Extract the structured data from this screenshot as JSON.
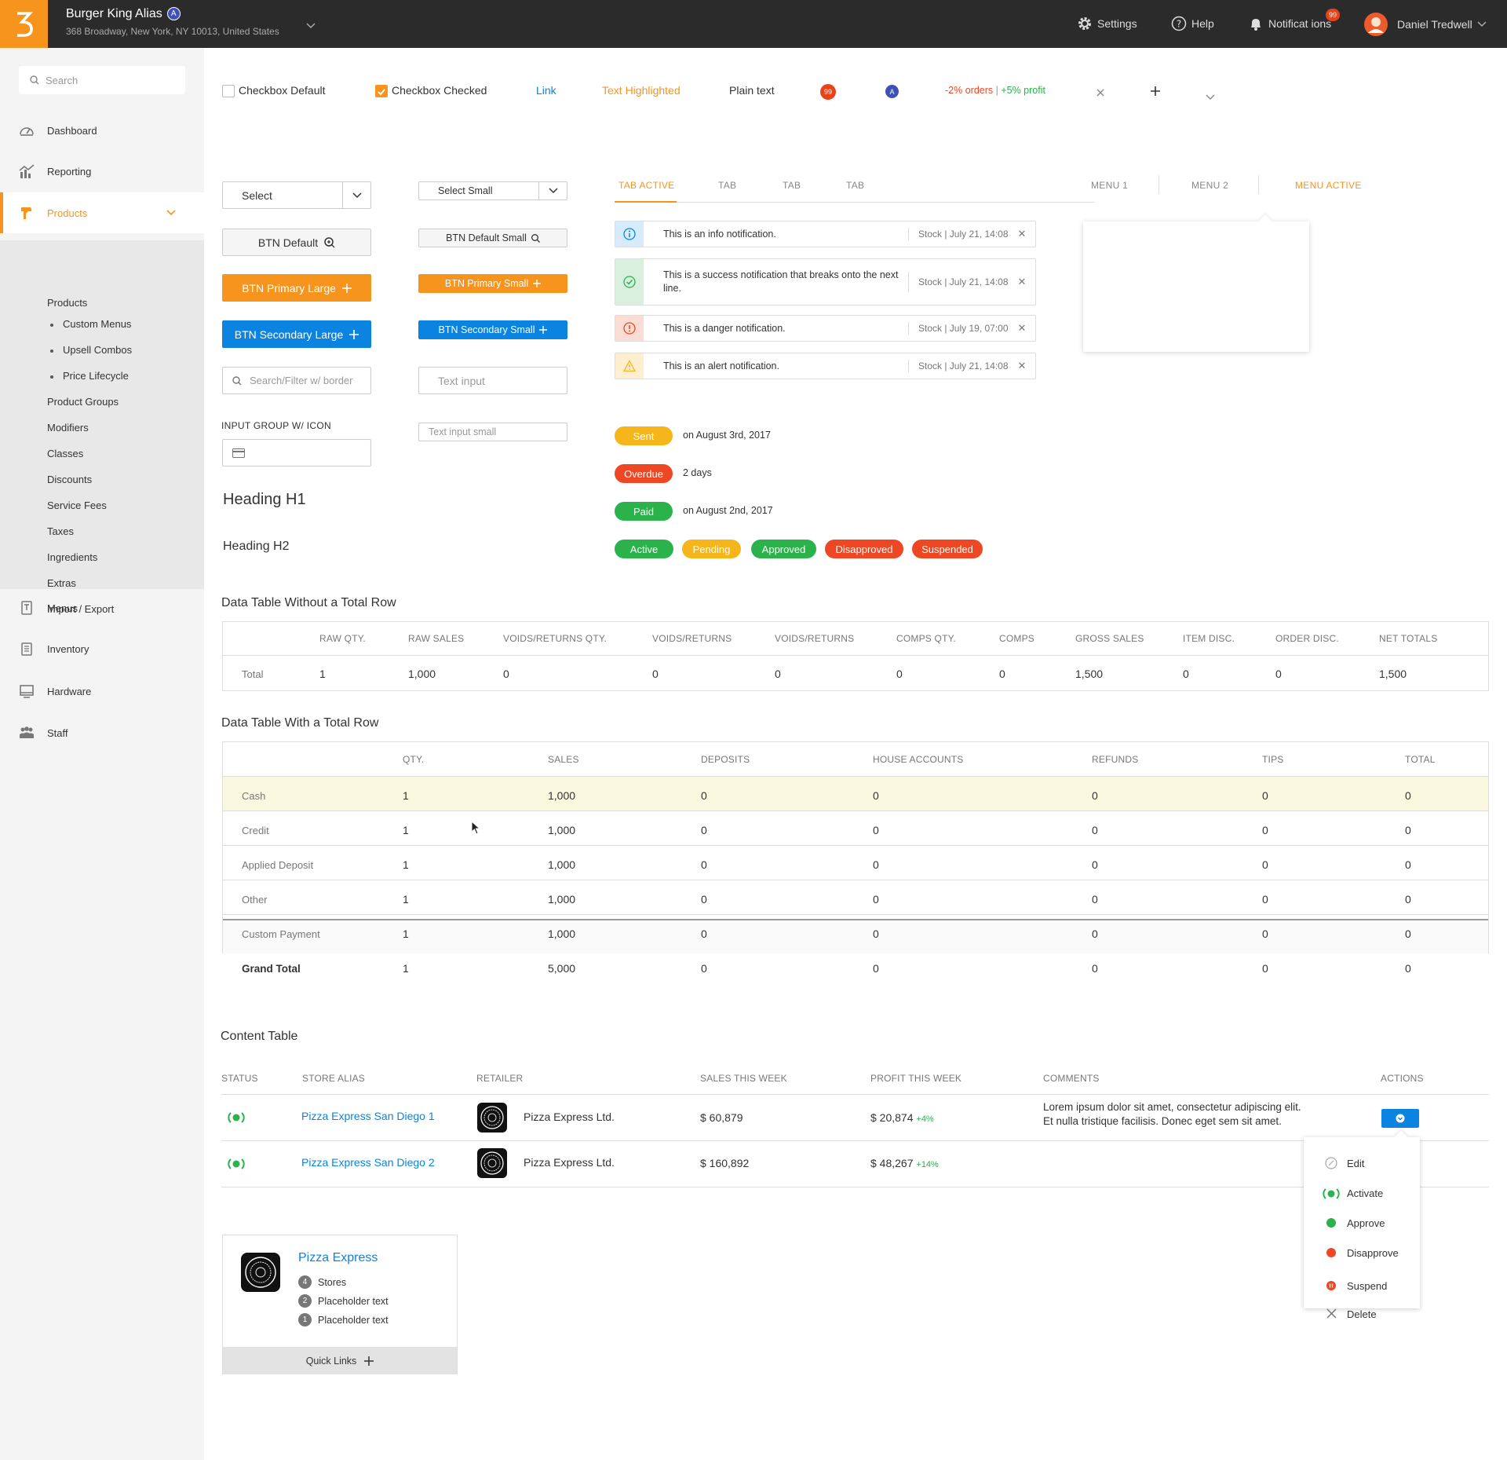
{
  "header": {
    "store_name": "Burger King Alias",
    "store_badge": "A",
    "store_address": "368 Broadway, New York, NY 10013, United States",
    "settings": "Settings",
    "help": "Help",
    "notifications": "Notificat ions",
    "notifications_count": "99",
    "user_name": "Daniel Tredwell"
  },
  "sidebar": {
    "search_placeholder": "Search",
    "items": [
      "Dashboard",
      "Reporting",
      "Products",
      "Menus",
      "Inventory",
      "Hardware",
      "Staff"
    ],
    "sub_items": [
      "Products",
      "Custom Menus",
      "Upsell Combos",
      "Price Lifecycle",
      "Product Groups",
      "Modifiers",
      "Classes",
      "Discounts",
      "Service Fees",
      "Taxes",
      "Ingredients",
      "Extras",
      "Import / Export"
    ]
  },
  "toprow": {
    "checkbox_default": "Checkbox Default",
    "checkbox_checked": "Checkbox Checked",
    "link": "Link",
    "highlighted": "Text Highlighted",
    "plain": "Plain text",
    "badge_count": "99",
    "badge_letter": "A",
    "orders": "-2% orders",
    "sep": " | ",
    "profit": "+5% profit"
  },
  "controls": {
    "select": "Select",
    "select_small": "Select Small",
    "btn_default": "BTN Default",
    "btn_default_small": "BTN Default Small",
    "btn_primary_large": "BTN Primary Large",
    "btn_primary_small": "BTN Primary Small",
    "btn_secondary_large": "BTN Secondary Large",
    "btn_secondary_small": "BTN Secondary Small",
    "search_filter_placeholder": "Search/Filter w/ border",
    "text_input_placeholder": "Text input",
    "input_group_label": "INPUT GROUP W/ ICON",
    "text_input_small_placeholder": "Text input small",
    "heading_h1": "Heading H1",
    "heading_h2": "Heading H2"
  },
  "tabs": [
    "TAB ACTIVE",
    "TAB",
    "TAB",
    "TAB"
  ],
  "menus": [
    "MENU 1",
    "MENU 2",
    "MENU ACTIVE"
  ],
  "notifications": [
    {
      "msg": "This is an info notification.",
      "meta": "Stock | July 21, 14:08"
    },
    {
      "msg": "This is a success notification that breaks onto the next line.",
      "meta": "Stock | July 21, 14:08"
    },
    {
      "msg": "This is a danger notification.",
      "meta": "Stock | July 19, 07:00"
    },
    {
      "msg": "This is an alert notification.",
      "meta": "Stock | July 21, 14:08"
    }
  ],
  "status_rows": [
    {
      "pill": "Sent",
      "text": "on August 3rd, 2017"
    },
    {
      "pill": "Overdue",
      "text": "2 days"
    },
    {
      "pill": "Paid",
      "text": "on August 2nd, 2017"
    }
  ],
  "status_pills": [
    "Active",
    "Pending",
    "Approved",
    "Disapproved",
    "Suspended"
  ],
  "table1": {
    "title": "Data Table Without a Total Row",
    "headers": [
      "RAW QTY.",
      "RAW SALES",
      "VOIDS/RETURNS QTY.",
      "VOIDS/RETURNS",
      "VOIDS/RETURNS",
      "COMPS QTY.",
      "COMPS",
      "GROSS SALES",
      "ITEM DISC.",
      "ORDER DISC.",
      "NET TOTALS"
    ],
    "row_label": "Total",
    "row": [
      "1",
      "1,000",
      "0",
      "0",
      "0",
      "0",
      "0",
      "1,500",
      "0",
      "0",
      "1,500"
    ]
  },
  "table2": {
    "title": "Data Table With a Total Row",
    "headers": [
      "QTY.",
      "SALES",
      "DEPOSITS",
      "HOUSE ACCOUNTS",
      "REFUNDS",
      "TIPS",
      "TOTAL"
    ],
    "rows": [
      {
        "label": "Cash",
        "cells": [
          "1",
          "1,000",
          "0",
          "0",
          "0",
          "0",
          "0"
        ]
      },
      {
        "label": "Credit",
        "cells": [
          "1",
          "1,000",
          "0",
          "0",
          "0",
          "0",
          "0"
        ]
      },
      {
        "label": "Applied Deposit",
        "cells": [
          "1",
          "1,000",
          "0",
          "0",
          "0",
          "0",
          "0"
        ]
      },
      {
        "label": "Other",
        "cells": [
          "1",
          "1,000",
          "0",
          "0",
          "0",
          "0",
          "0"
        ]
      },
      {
        "label": "Custom Payment",
        "cells": [
          "1",
          "1,000",
          "0",
          "0",
          "0",
          "0",
          "0"
        ]
      }
    ],
    "total": {
      "label": "Grand Total",
      "cells": [
        "1",
        "5,000",
        "0",
        "0",
        "0",
        "0",
        "0"
      ]
    }
  },
  "content_table": {
    "title": "Content Table",
    "headers": [
      "STATUS",
      "STORE ALIAS",
      "RETAILER",
      "SALES THIS WEEK",
      "PROFIT THIS WEEK",
      "COMMENTS",
      "ACTIONS"
    ],
    "rows": [
      {
        "alias": "Pizza Express San Diego 1",
        "retailer": "Pizza Express Ltd.",
        "sales": "$ 60,879",
        "profit": "$ 20,874",
        "delta": "+4%",
        "comment1": "Lorem ipsum dolor sit amet, consectetur adipiscing elit.",
        "comment2": "Et nulla tristique facilisis. Donec eget sem sit amet."
      },
      {
        "alias": "Pizza Express San Diego 2",
        "retailer": "Pizza Express Ltd.",
        "sales": "$ 160,892",
        "profit": "$ 48,267",
        "delta": "+14%"
      }
    ]
  },
  "actions_menu": [
    "Edit",
    "Activate",
    "Approve",
    "Disapprove",
    "Suspend",
    "Delete"
  ],
  "card": {
    "title": "Pizza Express",
    "items": [
      {
        "n": "4",
        "t": "Stores"
      },
      {
        "n": "2",
        "t": "Placeholder text"
      },
      {
        "n": "1",
        "t": "Placeholder text"
      }
    ],
    "quick_links": "Quick Links"
  },
  "colors": {
    "brand": "#f7941d",
    "link": "#0a84e0",
    "green": "#2cb24a",
    "yellow": "#f5b51b",
    "red": "#ee4723"
  }
}
